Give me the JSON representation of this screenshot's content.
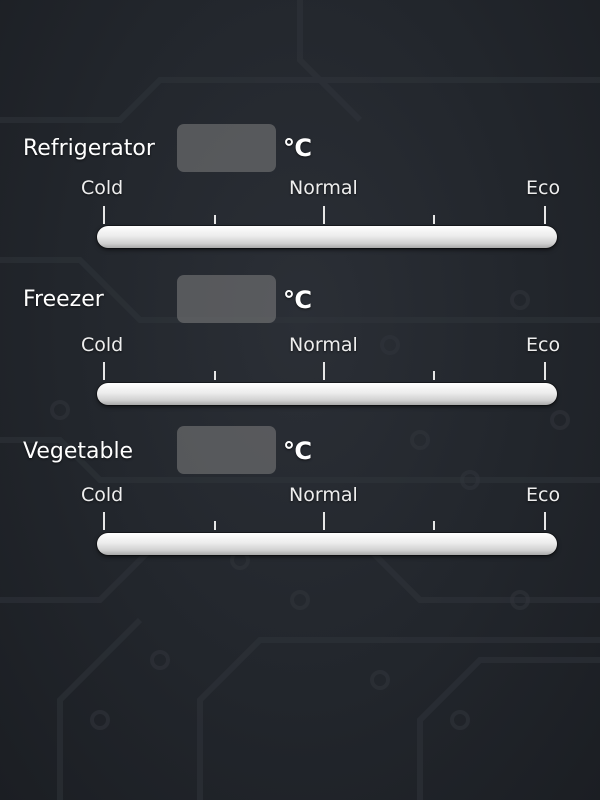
{
  "unit": "℃",
  "scale": {
    "cold": "Cold",
    "normal": "Normal",
    "eco": "Eco"
  },
  "sections": [
    {
      "label": "Refrigerator",
      "temperature": ""
    },
    {
      "label": "Freezer",
      "temperature": ""
    },
    {
      "label": "Vegetable",
      "temperature": ""
    }
  ],
  "colors": {
    "background": "#22262c",
    "track": "#e6e6e6",
    "temp_box": "#808080"
  }
}
